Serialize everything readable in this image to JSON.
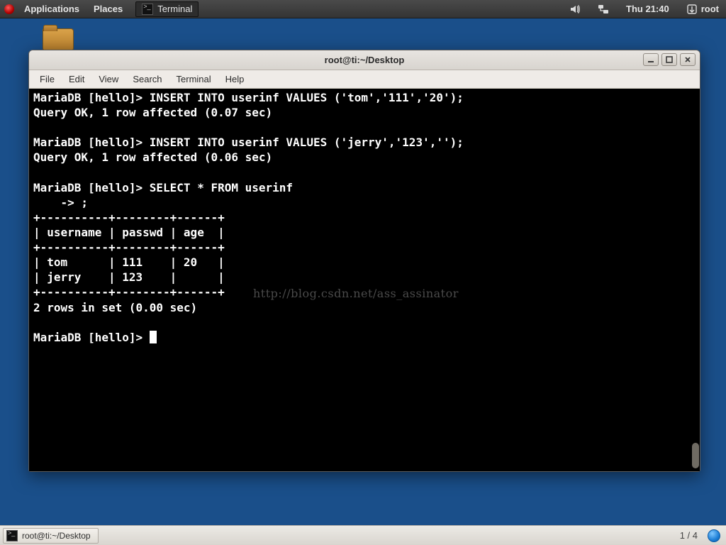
{
  "top_panel": {
    "applications": "Applications",
    "places": "Places",
    "running_app": "Terminal",
    "clock": "Thu 21:40",
    "user": "root"
  },
  "window": {
    "title": "root@ti:~/Desktop",
    "menu": {
      "file": "File",
      "edit": "Edit",
      "view": "View",
      "search": "Search",
      "terminal": "Terminal",
      "help": "Help"
    }
  },
  "terminal": {
    "lines": [
      "MariaDB [hello]> INSERT INTO userinf VALUES ('tom','111','20');",
      "Query OK, 1 row affected (0.07 sec)",
      "",
      "MariaDB [hello]> INSERT INTO userinf VALUES ('jerry','123','');",
      "Query OK, 1 row affected (0.06 sec)",
      "",
      "MariaDB [hello]> SELECT * FROM userinf",
      "    -> ;",
      "+----------+--------+------+",
      "| username | passwd | age  |",
      "+----------+--------+------+",
      "| tom      | 111    | 20   |",
      "| jerry    | 123    |      |",
      "+----------+--------+------+",
      "2 rows in set (0.00 sec)",
      "",
      "MariaDB [hello]> "
    ],
    "prompt_db": "hello",
    "table": {
      "columns": [
        "username",
        "passwd",
        "age"
      ],
      "rows": [
        {
          "username": "tom",
          "passwd": "111",
          "age": "20"
        },
        {
          "username": "jerry",
          "passwd": "123",
          "age": ""
        }
      ],
      "rowcount_text": "2 rows in set (0.00 sec)"
    }
  },
  "watermark": "http://blog.csdn.net/ass_assinator",
  "bottom_panel": {
    "task_label": "root@ti:~/Desktop",
    "workspace": "1 / 4"
  }
}
